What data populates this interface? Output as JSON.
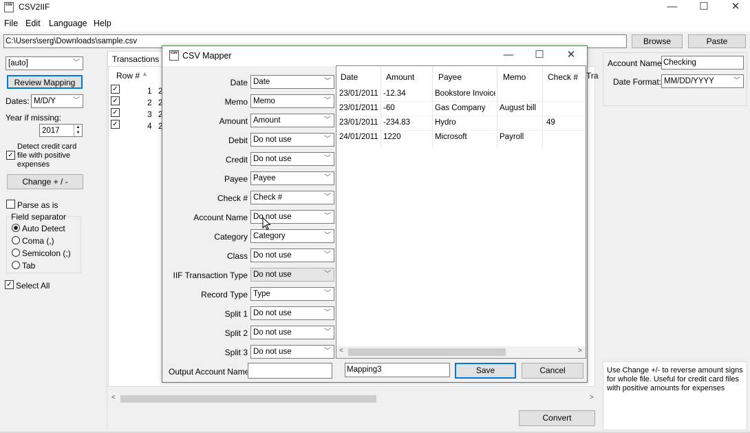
{
  "app": {
    "title": "CSV2IIF",
    "min": "—",
    "max": "☐",
    "close": "✕"
  },
  "menu": [
    "File",
    "Edit",
    "Language",
    "Help"
  ],
  "path": {
    "value": "C:\\Users\\serg\\Downloads\\sample.csv",
    "browse": "Browse",
    "paste": "Paste"
  },
  "left": {
    "auto_combo": "[auto]",
    "review_mapping": "Review Mapping",
    "dates_label": "Dates:",
    "dates_value": "M/D/Y",
    "year_label": "Year if missing:",
    "year_value": "2017",
    "detect_label": "Detect credit card file with positive expenses",
    "change": "Change + / -",
    "parse_label": "Parse as is",
    "sep_label": "Field separator",
    "radios": [
      "Auto Detect",
      "Coma (,)",
      "Semicolon (;)",
      "Tab"
    ],
    "select_all": "Select All"
  },
  "main": {
    "tab": "Transactions",
    "rownum_header": "Row #",
    "rows": [
      "1",
      "2",
      "3",
      "4"
    ],
    "row_prefix": [
      "2",
      "2",
      "2",
      "2"
    ],
    "convert": "Convert"
  },
  "right": {
    "account_label": "Account Name:",
    "account_value": "Checking",
    "datefmt_label": "Date Format:",
    "datefmt_value": "MM/DD/YYYY",
    "help": "Use Change +/- to reverse amount signs for whole file. Useful for credit card files with positive amounts for expenses"
  },
  "dialog": {
    "title": "CSV Mapper",
    "min": "—",
    "max": "☐",
    "close": "✕",
    "fields": [
      {
        "label": "Date",
        "value": "Date"
      },
      {
        "label": "Memo",
        "value": "Memo"
      },
      {
        "label": "Amount",
        "value": "Amount"
      },
      {
        "label": "Debit",
        "value": "Do not use"
      },
      {
        "label": "Credit",
        "value": "Do not use"
      },
      {
        "label": "Payee",
        "value": "Payee"
      },
      {
        "label": "Check #",
        "value": "Check #"
      },
      {
        "label": "Account Name",
        "value": "Do not use"
      },
      {
        "label": "Category",
        "value": "Category"
      },
      {
        "label": "Class",
        "value": "Do not use"
      },
      {
        "label": "IIF Transaction Type",
        "value": "Do not use"
      },
      {
        "label": "Record Type",
        "value": "Type"
      },
      {
        "label": "Split 1",
        "value": "Do not use"
      },
      {
        "label": "Split 2",
        "value": "Do not use"
      },
      {
        "label": "Split 3",
        "value": "Do not use"
      }
    ],
    "output_label": "Output Account Name:",
    "output_value": "",
    "mapping_name": "Mapping3",
    "save": "Save",
    "cancel": "Cancel",
    "preview_headers": [
      "Date",
      "Amount",
      "Payee",
      "Memo",
      "Check #",
      "Trai"
    ],
    "preview_rows": [
      [
        "23/01/2011",
        "-12.34",
        "Bookstore Invoice",
        "",
        ""
      ],
      [
        "23/01/2011",
        "-60",
        "Gas Company",
        "August bill",
        ""
      ],
      [
        "23/01/2011",
        "-234.83",
        "Hydro",
        "",
        "49"
      ],
      [
        "24/01/2011",
        "1220",
        "Microsoft",
        "Payroll",
        ""
      ]
    ]
  }
}
